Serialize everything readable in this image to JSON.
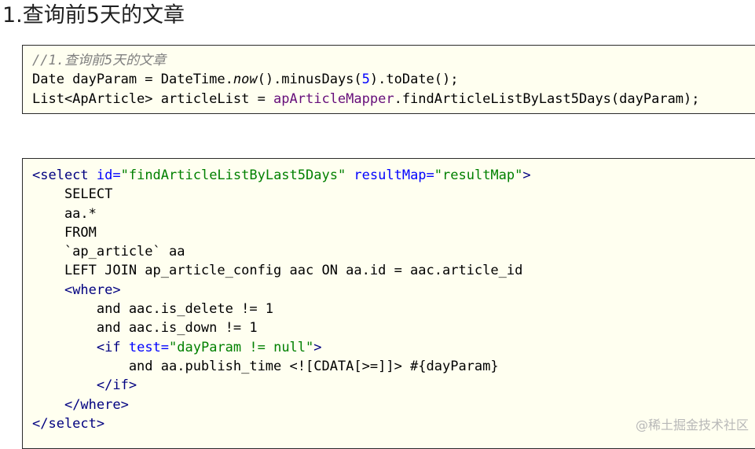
{
  "heading": "1.查询前5天的文章",
  "java": {
    "comment": "//1.查询前5天的文章",
    "line1": {
      "a": "Date dayParam = DateTime.",
      "now": "now",
      "b": "().minusDays(",
      "num": "5",
      "c": ").toDate();"
    },
    "line2": {
      "a": "List<ApArticle> articleList = ",
      "field": "apArticleMapper",
      "b": ".findArticleListByLast5Days(dayParam);"
    }
  },
  "xml": {
    "l1": {
      "open": "<select",
      "attr1": " id=",
      "val1": "\"findArticleListByLast5Days\"",
      "attr2": " resultMap=",
      "val2": "\"resultMap\"",
      "close": ">"
    },
    "l2": "    SELECT",
    "l3": "    aa.*",
    "l4": "    FROM",
    "l5": "    `ap_article` aa",
    "l6": "    LEFT JOIN ap_article_config aac ON aa.id = aac.article_id",
    "l7": {
      "indent": "    ",
      "tag": "<where>"
    },
    "l8": "        and aac.is_delete != 1",
    "l9": "        and aac.is_down != 1",
    "l10": {
      "indent": "        ",
      "open": "<if",
      "attr": " test=",
      "val": "\"dayParam != null\"",
      "close": ">"
    },
    "l11": "            and aa.publish_time <![CDATA[>=]]> #{dayParam}",
    "l12": {
      "indent": "        ",
      "tag": "</if>"
    },
    "l13": {
      "indent": "    ",
      "tag": "</where>"
    },
    "l14": {
      "tag": "</select>"
    }
  },
  "watermark": "@稀土掘金技术社区"
}
